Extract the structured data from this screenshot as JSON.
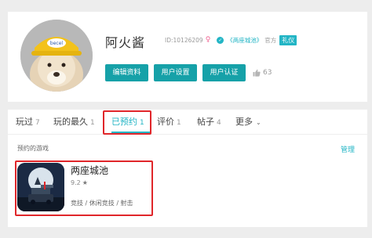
{
  "profile": {
    "username": "阿火酱",
    "id_text": "ID:10126209",
    "gender_symbol": "♀",
    "verify_mark": "✓",
    "game_link": "《两座城池》",
    "role": "官方",
    "badge": "礼仪",
    "buttons": {
      "edit": "编辑资料",
      "settings": "用户设置",
      "certify": "用户认证"
    },
    "likes": "63"
  },
  "tabs": [
    {
      "label": "玩过",
      "count": "7"
    },
    {
      "label": "玩的最久",
      "count": "1"
    },
    {
      "label": "已预约",
      "count": "1"
    },
    {
      "label": "评价",
      "count": "1"
    },
    {
      "label": "帖子",
      "count": "4"
    },
    {
      "label": "更多",
      "count": ""
    }
  ],
  "active_tab": "已预约",
  "reserved": {
    "section_title": "预约的游戏",
    "manage_label": "管理",
    "game": {
      "name": "两座城池",
      "rating": "9.2",
      "rating_icon": "★",
      "tags": "竞技 / 休闲竞技 / 射击"
    }
  },
  "colors": {
    "accent": "#23b5c5",
    "button": "#16a1a8",
    "highlight_box": "#e0262a",
    "background": "#ededed"
  }
}
